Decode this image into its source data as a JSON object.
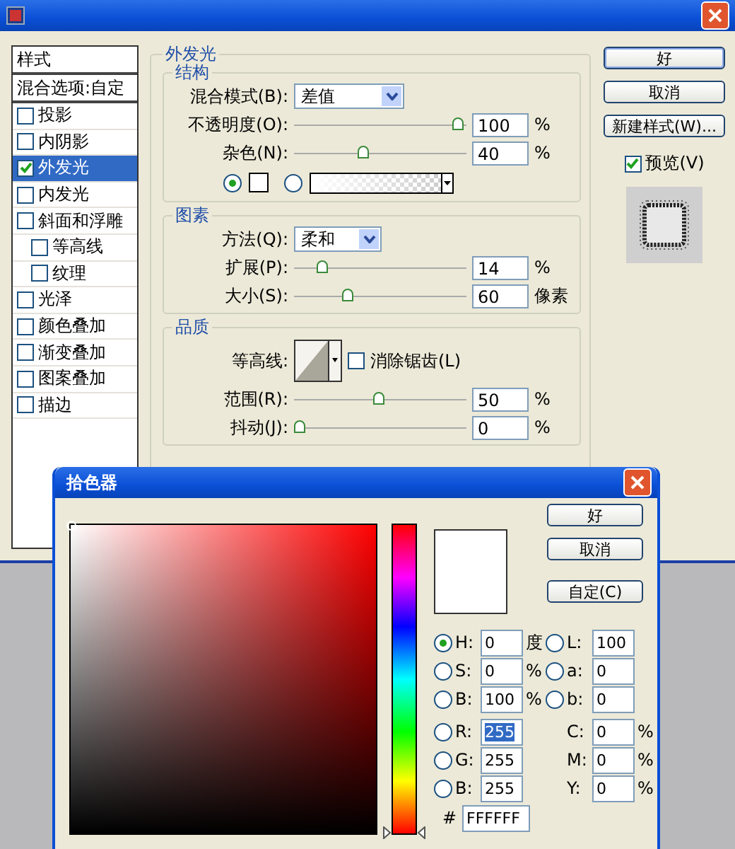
{
  "layer_style": {
    "styles": [
      {
        "label": "样式",
        "kind": "heading",
        "selected": false
      },
      {
        "label": "混合选项:自定",
        "kind": "heading",
        "selected": false
      },
      {
        "label": "投影",
        "kind": "effect",
        "checked": false,
        "selected": false
      },
      {
        "label": "内阴影",
        "kind": "effect",
        "checked": false,
        "selected": false
      },
      {
        "label": "外发光",
        "kind": "effect",
        "checked": true,
        "selected": true
      },
      {
        "label": "内发光",
        "kind": "effect",
        "checked": false,
        "selected": false
      },
      {
        "label": "斜面和浮雕",
        "kind": "effect",
        "checked": false,
        "selected": false
      },
      {
        "label": "等高线",
        "kind": "sub_effect",
        "checked": false,
        "selected": false
      },
      {
        "label": "纹理",
        "kind": "sub_effect",
        "checked": false,
        "selected": false
      },
      {
        "label": "光泽",
        "kind": "effect",
        "checked": false,
        "selected": false
      },
      {
        "label": "颜色叠加",
        "kind": "effect",
        "checked": false,
        "selected": false
      },
      {
        "label": "渐变叠加",
        "kind": "effect",
        "checked": false,
        "selected": false
      },
      {
        "label": "图案叠加",
        "kind": "effect",
        "checked": false,
        "selected": false
      },
      {
        "label": "描边",
        "kind": "effect",
        "checked": false,
        "selected": false
      }
    ],
    "panel_title": "外发光",
    "structure": {
      "title": "结构",
      "blend_mode": {
        "label": "混合模式(B):",
        "value": "差值"
      },
      "opacity": {
        "label": "不透明度(O):",
        "level": 1.0,
        "value": "100",
        "unit": "%"
      },
      "noise": {
        "label": "杂色(N):",
        "level": 0.4,
        "value": "40",
        "unit": "%"
      },
      "fill": [
        {
          "kind": "color",
          "selected": true
        },
        {
          "kind": "gradient",
          "selected": false
        }
      ]
    },
    "elements": {
      "title": "图素",
      "technique": {
        "label": "方法(Q):",
        "value": "柔和"
      },
      "spread": {
        "label": "扩展(P):",
        "level": 0.14,
        "value": "14",
        "unit": "%"
      },
      "size": {
        "label": "大小(S):",
        "level": 0.3,
        "value": "60",
        "unit": "像素"
      }
    },
    "quality": {
      "title": "品质",
      "contour": {
        "label": "等高线:"
      },
      "anti_alias": {
        "label": "消除锯齿(L)",
        "checked": false
      },
      "range": {
        "label": "范围(R):",
        "level": 0.5,
        "value": "50",
        "unit": "%"
      },
      "jitter": {
        "label": "抖动(J):",
        "level": 0,
        "value": "0",
        "unit": "%"
      }
    },
    "buttons": [
      "好",
      "取消",
      "新建样式(W)..."
    ],
    "preview": {
      "label": "预览(V)",
      "checked": true
    }
  },
  "color_picker": {
    "title": "拾色器",
    "buttons": [
      "好",
      "取消",
      "自定(C)"
    ],
    "hue": {
      "level": 0
    },
    "fields_left": [
      {
        "kind": "radio",
        "label": "H:",
        "value": "0",
        "unit": "度",
        "selected": true,
        "highlighted": false
      },
      {
        "kind": "radio",
        "label": "S:",
        "value": "0",
        "unit": "%",
        "selected": false,
        "highlighted": false
      },
      {
        "kind": "radio",
        "label": "B:",
        "value": "100",
        "unit": "%",
        "selected": false,
        "highlighted": false
      },
      {
        "kind": "radio",
        "label": "R:",
        "value": "255",
        "selected": false,
        "highlighted": true
      },
      {
        "kind": "radio",
        "label": "G:",
        "value": "255",
        "selected": false,
        "highlighted": false
      },
      {
        "kind": "radio",
        "label": "B:",
        "value": "255",
        "selected": false,
        "highlighted": false
      }
    ],
    "fields_right": [
      {
        "kind": "radio",
        "label": "L:",
        "value": "100",
        "selected": false
      },
      {
        "kind": "radio",
        "label": "a:",
        "value": "0",
        "selected": false
      },
      {
        "kind": "radio",
        "label": "b:",
        "value": "0",
        "selected": false
      },
      {
        "kind": "plain",
        "label": "C:",
        "value": "0",
        "unit": "%"
      },
      {
        "kind": "plain",
        "label": "M:",
        "value": "0",
        "unit": "%"
      },
      {
        "kind": "plain",
        "label": "Y:",
        "value": "0",
        "unit": "%"
      }
    ],
    "hex": {
      "label": "#",
      "value": "FFFFFF"
    }
  }
}
